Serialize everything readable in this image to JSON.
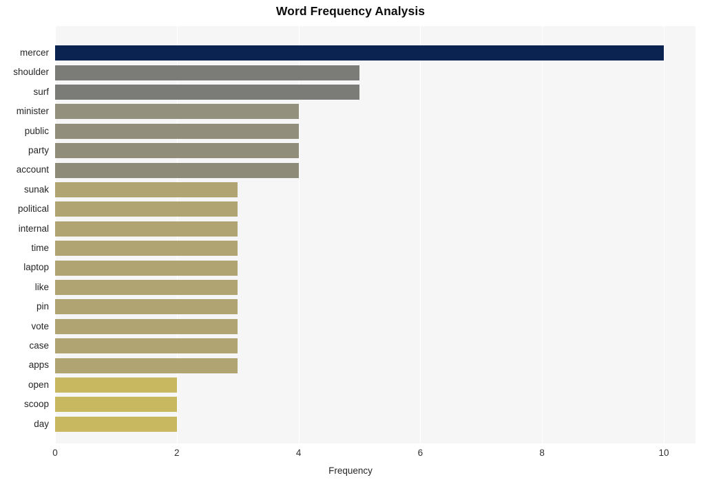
{
  "chart_data": {
    "type": "bar",
    "orientation": "horizontal",
    "title": "Word Frequency Analysis",
    "xlabel": "Frequency",
    "ylabel": "",
    "xlim": [
      0,
      10
    ],
    "xticks": [
      0,
      2,
      4,
      6,
      8,
      10
    ],
    "xtick_labels": [
      "0",
      "2",
      "4",
      "6",
      "8",
      "10"
    ],
    "grid": true,
    "grid_axis": "x",
    "legend": null,
    "plot_background": "#f6f6f6",
    "categories": [
      "mercer",
      "shoulder",
      "surf",
      "minister",
      "public",
      "party",
      "account",
      "sunak",
      "political",
      "internal",
      "time",
      "laptop",
      "like",
      "pin",
      "vote",
      "case",
      "apps",
      "open",
      "scoop",
      "day"
    ],
    "values": [
      10,
      5,
      5,
      4,
      4,
      4,
      4,
      3,
      3,
      3,
      3,
      3,
      3,
      3,
      3,
      3,
      3,
      2,
      2,
      2
    ],
    "bar_colors": [
      "#0a2351",
      "#7b7b78",
      "#7b7b78",
      "#94907e",
      "#928e7c",
      "#918d7b",
      "#8f8b79",
      "#b0a473",
      "#b0a473",
      "#b0a473",
      "#b0a473",
      "#b0a473",
      "#b0a473",
      "#b0a473",
      "#b0a473",
      "#b0a473",
      "#b0a473",
      "#c8b85f",
      "#c8b85f",
      "#c8b85f"
    ]
  }
}
